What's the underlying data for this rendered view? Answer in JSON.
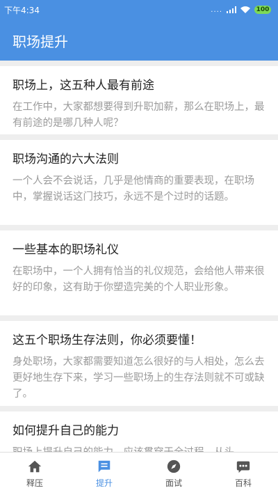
{
  "status": {
    "time": "下午4:34",
    "signal": "....",
    "battery": "100"
  },
  "header": {
    "title": "职场提升"
  },
  "articles": [
    {
      "title": "职场上，这五种人最有前途",
      "desc": "在工作中，大家都想要得到升职加薪，那么在职场上，最有前途的是哪几种人呢？"
    },
    {
      "title": "职场沟通的六大法则",
      "desc": "一个人会不会说话，几乎是他情商的重要表现，在职场中，掌握说话这门技巧，永远不是个过时的话题。"
    },
    {
      "title": "一些基本的职场礼仪",
      "desc": "在职场中，一个人拥有恰当的礼仪规范，会给他人带来很好的印象，这有助于你塑造完美的个人职业形象。"
    },
    {
      "title": "这五个职场生存法则，你必须要懂！",
      "desc": "身处职场，大家都需要知道怎么很好的与人相处，怎么去更好地生存下来，学习一些职场上的生存法则就不可或缺了。"
    },
    {
      "title": "如何提升自己的能力",
      "desc": "职场上提升自己的能力，应该贯穿于全过程，从头"
    }
  ],
  "nav": {
    "items": [
      {
        "label": "释压",
        "icon": "home-icon"
      },
      {
        "label": "提升",
        "icon": "chat-icon"
      },
      {
        "label": "面试",
        "icon": "compass-icon"
      },
      {
        "label": "百科",
        "icon": "more-chat-icon"
      }
    ],
    "active_color": "#4a90e2"
  }
}
